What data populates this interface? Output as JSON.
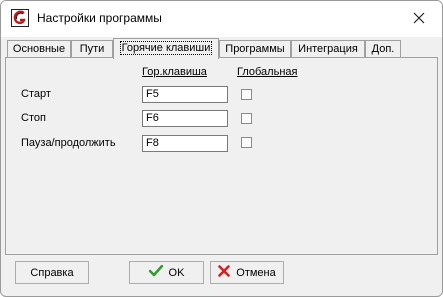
{
  "window": {
    "title": "Настройки программы",
    "app_icon": "g-logo-icon",
    "close_icon": "close-icon"
  },
  "tabs": [
    {
      "label": "Основные",
      "active": false
    },
    {
      "label": "Пути",
      "active": false
    },
    {
      "label": "Горячие клавиши",
      "active": true
    },
    {
      "label": "Программы",
      "active": false
    },
    {
      "label": "Интеграция",
      "active": false
    },
    {
      "label": "Доп.",
      "active": false
    }
  ],
  "hotkeys": {
    "col_hotkey": "Гор.клавиша",
    "col_global": "Глобальная",
    "rows": [
      {
        "label": "Старт",
        "key": "F5",
        "global": false
      },
      {
        "label": "Стоп",
        "key": "F6",
        "global": false
      },
      {
        "label": "Пауза/продолжить",
        "key": "F8",
        "global": false
      }
    ]
  },
  "buttons": {
    "help": "Справка",
    "ok": "OK",
    "cancel": "Отмена",
    "ok_icon": "checkmark-icon",
    "cancel_icon": "x-icon",
    "ok_color": "#2e9e2e",
    "cancel_color": "#d42020"
  }
}
